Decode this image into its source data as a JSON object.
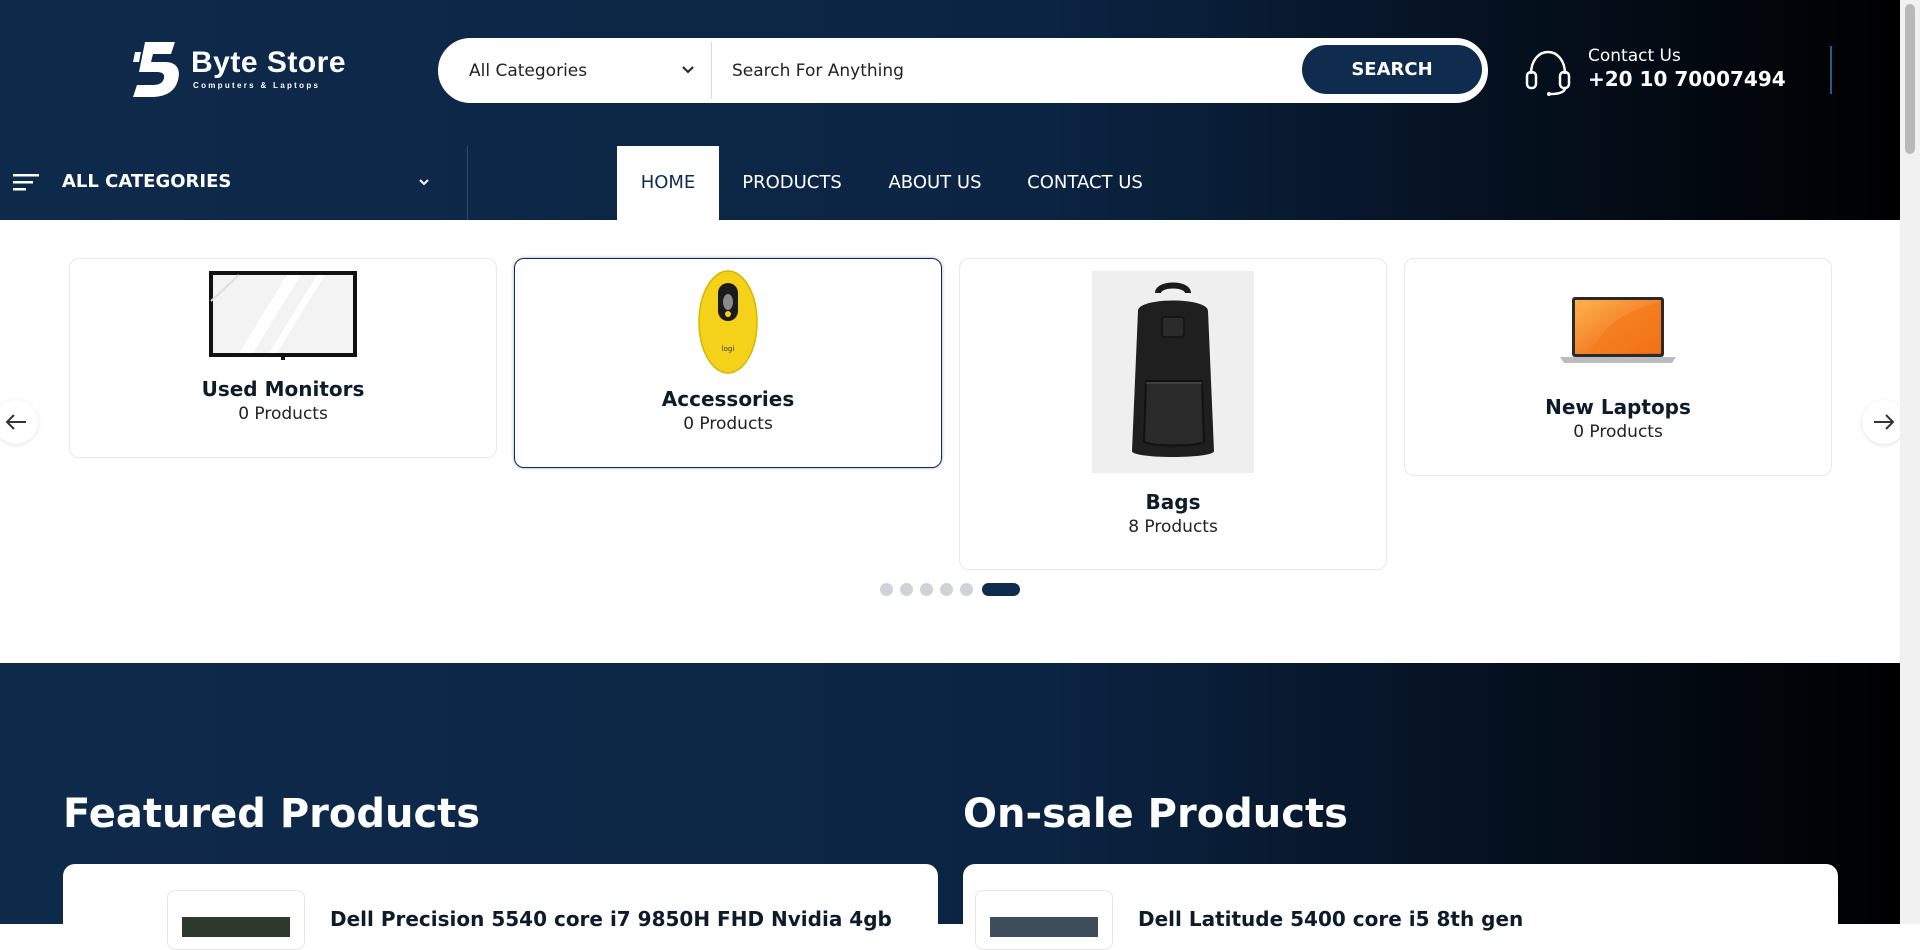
{
  "header": {
    "logo": {
      "name": "Byte Store",
      "tagline": "Computers & Laptops"
    },
    "search": {
      "category_selected": "All Categories",
      "placeholder": "Search For Anything",
      "button_label": "SEARCH"
    },
    "contact": {
      "label": "Contact Us",
      "phone": "+20 10 70007494"
    }
  },
  "nav": {
    "all_categories_label": "ALL CATEGORIES",
    "links": [
      {
        "label": "HOME",
        "active": true
      },
      {
        "label": "PRODUCTS",
        "active": false
      },
      {
        "label": "ABOUT US",
        "active": false
      },
      {
        "label": "CONTACT US",
        "active": false
      }
    ]
  },
  "categories": {
    "items": [
      {
        "title": "Used Monitors",
        "count": "0 Products",
        "icon": "monitor-image"
      },
      {
        "title": "Accessories",
        "count": "0 Products",
        "icon": "mouse-image"
      },
      {
        "title": "Bags",
        "count": "8 Products",
        "icon": "backpack-image"
      },
      {
        "title": "New Laptops",
        "count": "0 Products",
        "icon": "laptop-image"
      }
    ],
    "pagination": {
      "total": 6,
      "active_index": 5
    }
  },
  "featured": {
    "title": "Featured Products",
    "first_product": "Dell Precision 5540 core i7 9850H FHD Nvidia 4gb"
  },
  "onsale": {
    "title": "On-sale Products",
    "first_product": "Dell Latitude 5400 core i5 8th gen"
  },
  "colors": {
    "primary": "#0f2b4d",
    "header_gradient_start": "#0e2a4b",
    "header_gradient_end": "#000000",
    "mouse_yellow": "#f5d21a",
    "laptop_orange": "#f58a1f"
  }
}
